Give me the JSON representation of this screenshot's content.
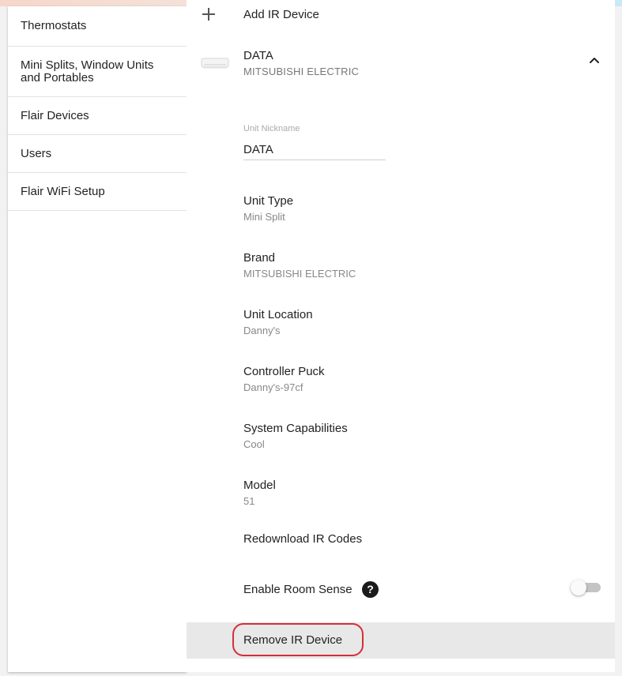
{
  "sidebar": {
    "items": [
      {
        "label": "Thermostats"
      },
      {
        "label": "Mini Splits, Window Units and Portables"
      },
      {
        "label": "Flair Devices"
      },
      {
        "label": "Users"
      },
      {
        "label": "Flair WiFi Setup"
      }
    ]
  },
  "main": {
    "add_device_label": "Add IR Device",
    "device": {
      "name": "DATA",
      "brand": "MITSUBISHI ELECTRIC"
    },
    "nickname": {
      "label": "Unit Nickname",
      "value": "DATA"
    },
    "fields": {
      "unit_type": {
        "label": "Unit Type",
        "value": "Mini Split"
      },
      "brand": {
        "label": "Brand",
        "value": "MITSUBISHI ELECTRIC"
      },
      "unit_location": {
        "label": "Unit Location",
        "value": "Danny's"
      },
      "controller_puck": {
        "label": "Controller Puck",
        "value": "Danny's-97cf"
      },
      "system_capabilities": {
        "label": "System Capabilities",
        "value": "Cool"
      },
      "model": {
        "label": "Model",
        "value": "51"
      }
    },
    "redownload_label": "Redownload IR Codes",
    "room_sense": {
      "label": "Enable Room Sense",
      "help_glyph": "?",
      "enabled": false
    },
    "remove_label": "Remove IR Device"
  },
  "colors": {
    "highlight_border": "#d32f3a",
    "toggle_track": "#c4c4c4",
    "remove_row_bg": "#e8e8e8"
  }
}
